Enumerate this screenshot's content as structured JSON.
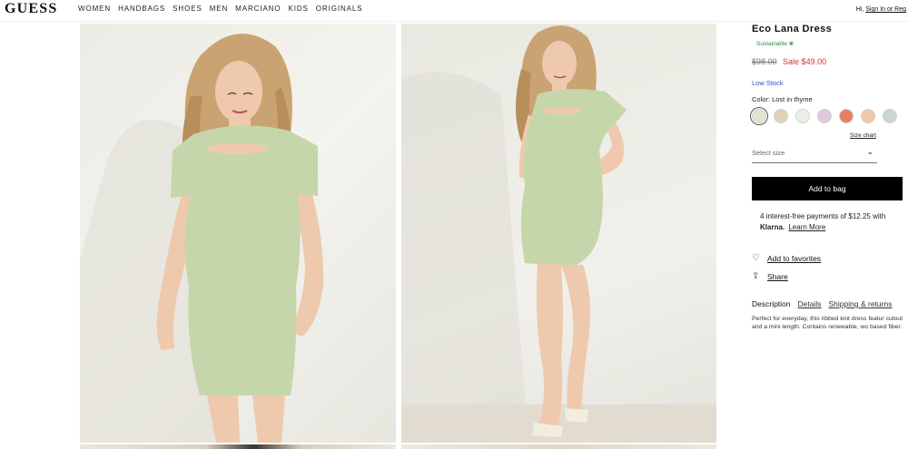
{
  "header": {
    "logo": "GUESS",
    "nav": [
      "WOMEN",
      "HANDBAGS",
      "SHOES",
      "MEN",
      "MARCIANO",
      "KIDS",
      "ORIGINALS"
    ],
    "greeting": "Hi,",
    "signin": "Sign In or Reg"
  },
  "product": {
    "title": "Eco Lana Dress",
    "sustainable": "Sustainable",
    "original_price": "$98.00",
    "sale_price": "Sale $49.00",
    "stock": "Low Stock",
    "color_label": "Color: Lost in thyme",
    "swatches": [
      "#dfe5cf",
      "#e1d2b5",
      "#eeeee6",
      "#e2c7dd",
      "#ea7d63",
      "#f2c7a8",
      "#c9d6d3"
    ],
    "size_chart": "Size chart",
    "select_size": "Select size",
    "add_to_bag": "Add to bag",
    "klarna_line1": "4 interest-free payments of $12.25 with",
    "klarna_logo": "Klarna.",
    "klarna_learn": "Learn More",
    "favorites": "Add to favorites",
    "share": "Share",
    "tabs": [
      "Description",
      "Details",
      "Shipping & returns"
    ],
    "description": "Perfect for everyday, this ribbed knit dress featur cutout and a mini length. Contains renewable, wo based fiber."
  },
  "colors": {
    "sale": "#d0342c",
    "stock": "#2a58c4",
    "sustainable": "#2f8a3c",
    "dress": "#c5d6aa",
    "button": "#000000"
  }
}
